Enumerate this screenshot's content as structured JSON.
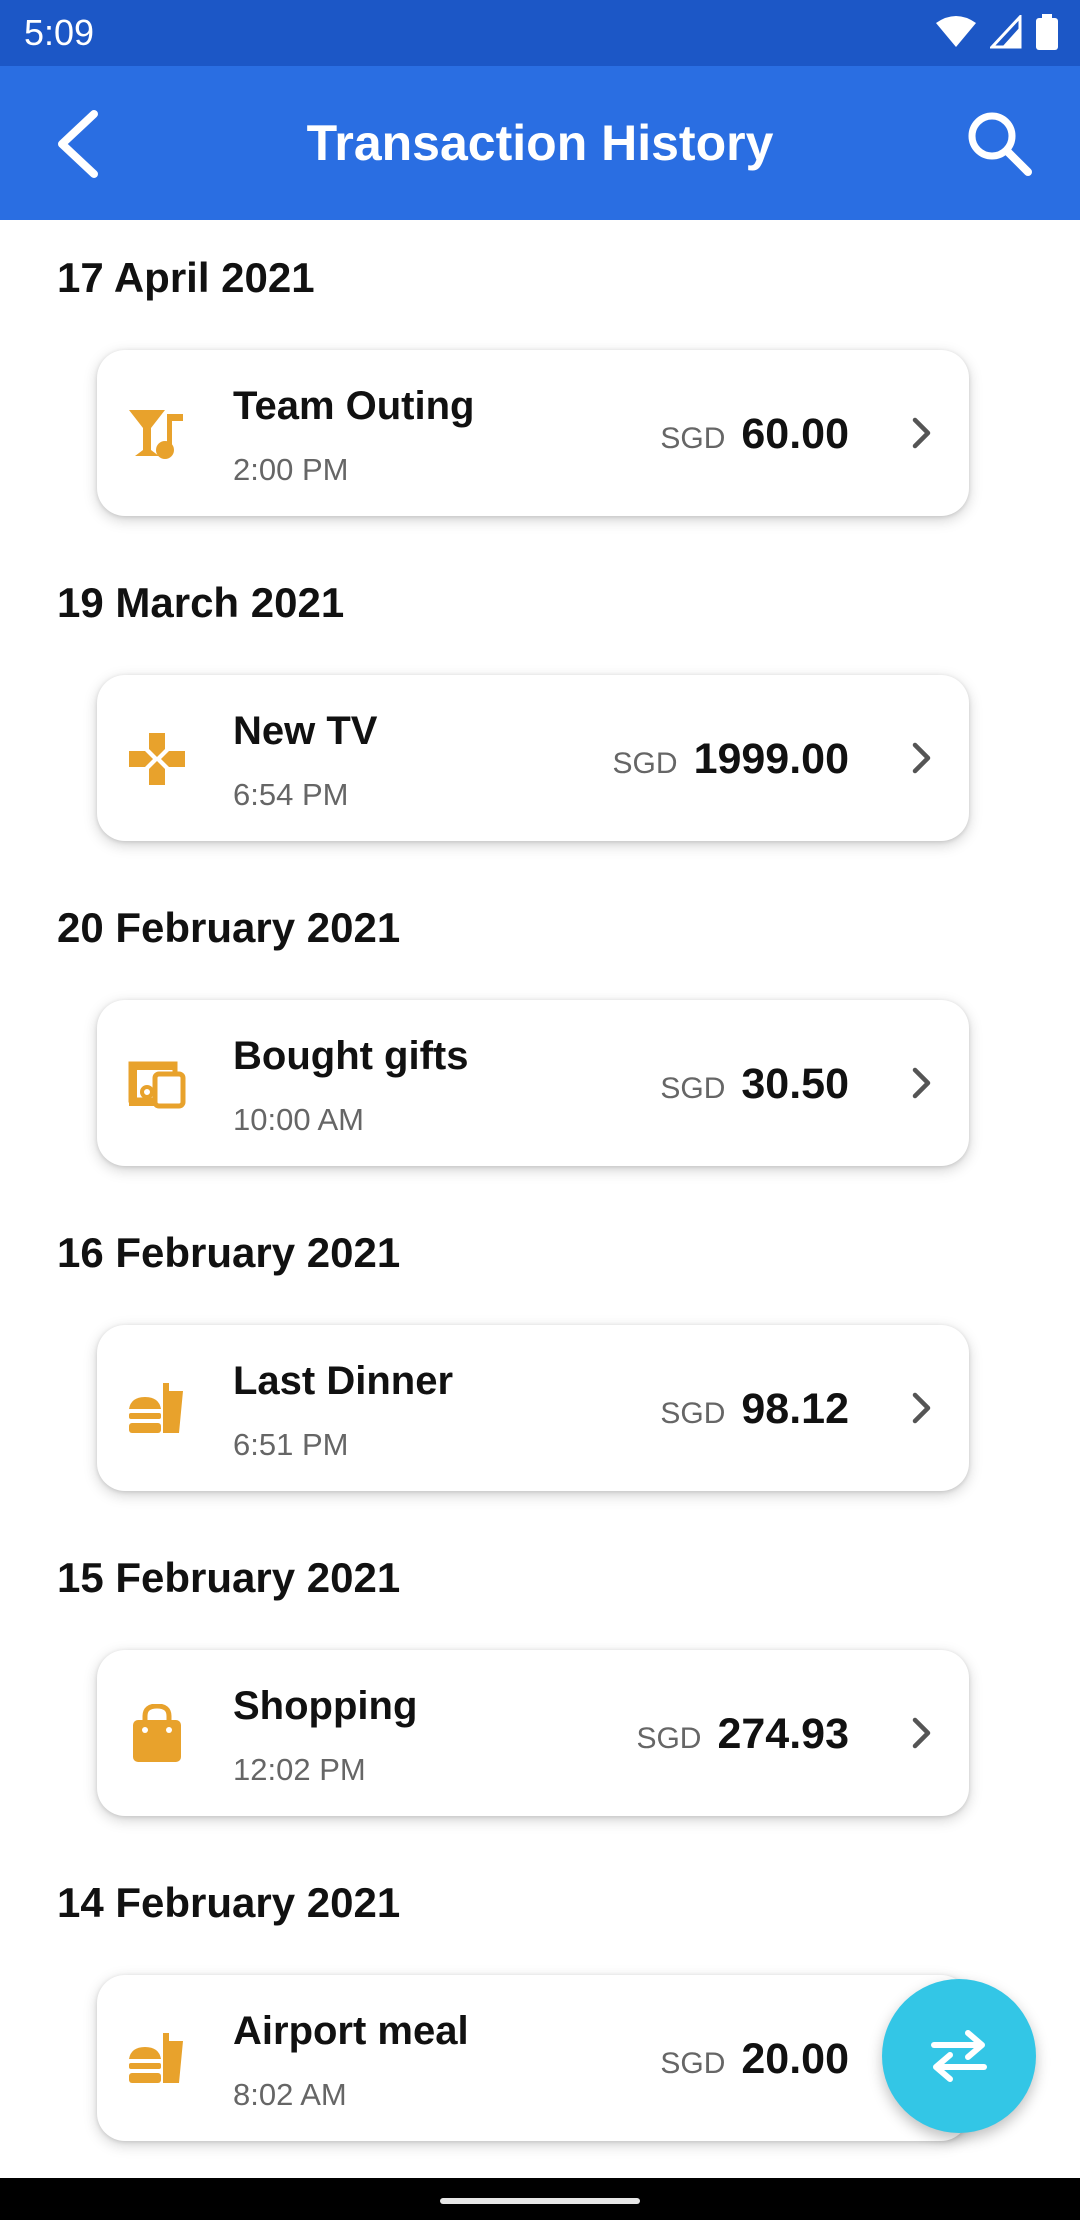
{
  "status_bar": {
    "time": "5:09"
  },
  "app_bar": {
    "title": "Transaction History"
  },
  "transactions": [
    {
      "date": "17 April 2021",
      "name": "Team Outing",
      "time": "2:00 PM",
      "currency": "SGD",
      "amount": "60.00",
      "icon": "cocktail-music-icon"
    },
    {
      "date": "19 March 2021",
      "name": "New TV",
      "time": "6:54 PM",
      "currency": "SGD",
      "amount": "1999.00",
      "icon": "gamepad-icon"
    },
    {
      "date": "20 February 2021",
      "name": "Bought gifts",
      "time": "10:00 AM",
      "currency": "SGD",
      "amount": "30.50",
      "icon": "devices-icon"
    },
    {
      "date": "16 February 2021",
      "name": "Last Dinner",
      "time": "6:51 PM",
      "currency": "SGD",
      "amount": "98.12",
      "icon": "fastfood-icon"
    },
    {
      "date": "15 February 2021",
      "name": "Shopping",
      "time": "12:02 PM",
      "currency": "SGD",
      "amount": "274.93",
      "icon": "shopping-bag-icon"
    },
    {
      "date": "14 February 2021",
      "name": "Airport meal",
      "time": "8:02 AM",
      "currency": "SGD",
      "amount": "20.00",
      "icon": "fastfood-icon"
    }
  ],
  "colors": {
    "app_bar": "#2a6ee2",
    "status_bar": "#1c57c6",
    "category_icon": "#e8a22c",
    "fab": "#33c6e6"
  },
  "fab": {
    "icon": "swap-arrows-icon"
  }
}
